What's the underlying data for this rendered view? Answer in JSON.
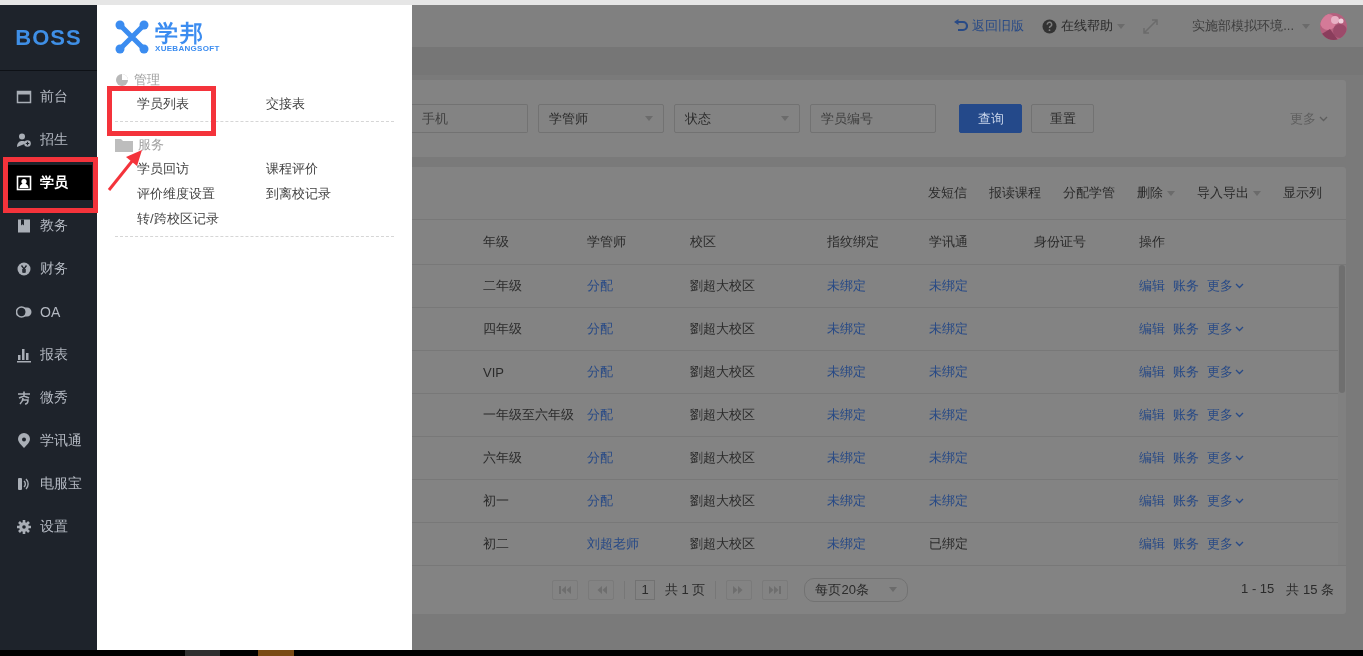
{
  "sidebar": {
    "logo": "BOSS",
    "items": [
      {
        "label": "前台",
        "selected": false
      },
      {
        "label": "招生",
        "selected": false
      },
      {
        "label": "学员",
        "selected": true
      },
      {
        "label": "教务",
        "selected": false
      },
      {
        "label": "财务",
        "selected": false
      },
      {
        "label": "OA",
        "selected": false
      },
      {
        "label": "报表",
        "selected": false
      },
      {
        "label": "微秀",
        "selected": false
      },
      {
        "label": "学讯通",
        "selected": false
      },
      {
        "label": "电服宝",
        "selected": false
      },
      {
        "label": "设置",
        "selected": false
      }
    ]
  },
  "flyout": {
    "brand": "学邦",
    "brand_sub": "XUEBANGSOFT",
    "sections": [
      {
        "title": "管理",
        "items": [
          "学员列表",
          "交接表"
        ]
      },
      {
        "title": "服务",
        "items": [
          "学员回访",
          "课程评价",
          "评价维度设置",
          "到离校记录",
          "转/跨校区记录"
        ]
      }
    ]
  },
  "header": {
    "back_link": "返回旧版",
    "help": "在线帮助",
    "user": "实施部模拟环境..."
  },
  "filters": [
    {
      "kind": "input",
      "placeholder": "手机"
    },
    {
      "kind": "select",
      "value": "学管师"
    },
    {
      "kind": "select",
      "value": "状态"
    },
    {
      "kind": "input",
      "placeholder": "学员编号"
    }
  ],
  "filter_buttons": [
    {
      "label": "查询",
      "primary": true
    },
    {
      "label": "重置",
      "primary": false
    }
  ],
  "filter_more": "更多",
  "toolbar": [
    {
      "label": "发短信",
      "dropdown": false
    },
    {
      "label": "报读课程",
      "dropdown": false
    },
    {
      "label": "分配学管",
      "dropdown": false
    },
    {
      "label": "删除",
      "dropdown": true
    },
    {
      "label": "导入导出",
      "dropdown": true
    },
    {
      "label": "显示列",
      "dropdown": false
    }
  ],
  "table": {
    "columns": [
      "年级",
      "学管师",
      "校区",
      "指纹绑定",
      "学讯通",
      "身份证号",
      "操作"
    ],
    "rows": [
      {
        "grade": "二年级",
        "manager": "分配",
        "campus": "劉超大校区",
        "fingerprint": {
          "text": "未绑定",
          "bound": false
        },
        "xuexuntong": {
          "text": "未绑定",
          "bound": false
        },
        "actions": [
          "编辑",
          "账务",
          "更多"
        ]
      },
      {
        "grade": "四年级",
        "manager": "分配",
        "campus": "劉超大校区",
        "fingerprint": {
          "text": "未绑定",
          "bound": false
        },
        "xuexuntong": {
          "text": "未绑定",
          "bound": false
        },
        "actions": [
          "编辑",
          "账务",
          "更多"
        ]
      },
      {
        "grade": "VIP",
        "manager": "分配",
        "campus": "劉超大校区",
        "fingerprint": {
          "text": "未绑定",
          "bound": false
        },
        "xuexuntong": {
          "text": "未绑定",
          "bound": false
        },
        "actions": [
          "编辑",
          "账务",
          "更多"
        ]
      },
      {
        "grade": "一年级至六年级",
        "manager": "分配",
        "campus": "劉超大校区",
        "fingerprint": {
          "text": "未绑定",
          "bound": false
        },
        "xuexuntong": {
          "text": "未绑定",
          "bound": false
        },
        "actions": [
          "编辑",
          "账务",
          "更多"
        ]
      },
      {
        "grade": "六年级",
        "manager": "分配",
        "campus": "劉超大校区",
        "fingerprint": {
          "text": "未绑定",
          "bound": false
        },
        "xuexuntong": {
          "text": "未绑定",
          "bound": false
        },
        "actions": [
          "编辑",
          "账务",
          "更多"
        ]
      },
      {
        "grade": "初一",
        "manager": "分配",
        "campus": "劉超大校区",
        "fingerprint": {
          "text": "未绑定",
          "bound": false
        },
        "xuexuntong": {
          "text": "未绑定",
          "bound": false
        },
        "actions": [
          "编辑",
          "账务",
          "更多"
        ]
      },
      {
        "grade": "初二",
        "manager": "刘超老师",
        "campus": "劉超大校区",
        "fingerprint": {
          "text": "未绑定",
          "bound": false
        },
        "xuexuntong": {
          "text": "已绑定",
          "bound": true
        },
        "actions": [
          "编辑",
          "账务",
          "更多"
        ]
      }
    ]
  },
  "pagination": {
    "page": "1",
    "total_pages": "共 1 页",
    "page_size": "每页20条",
    "range": "1 - 15",
    "total": "共 15 条"
  }
}
